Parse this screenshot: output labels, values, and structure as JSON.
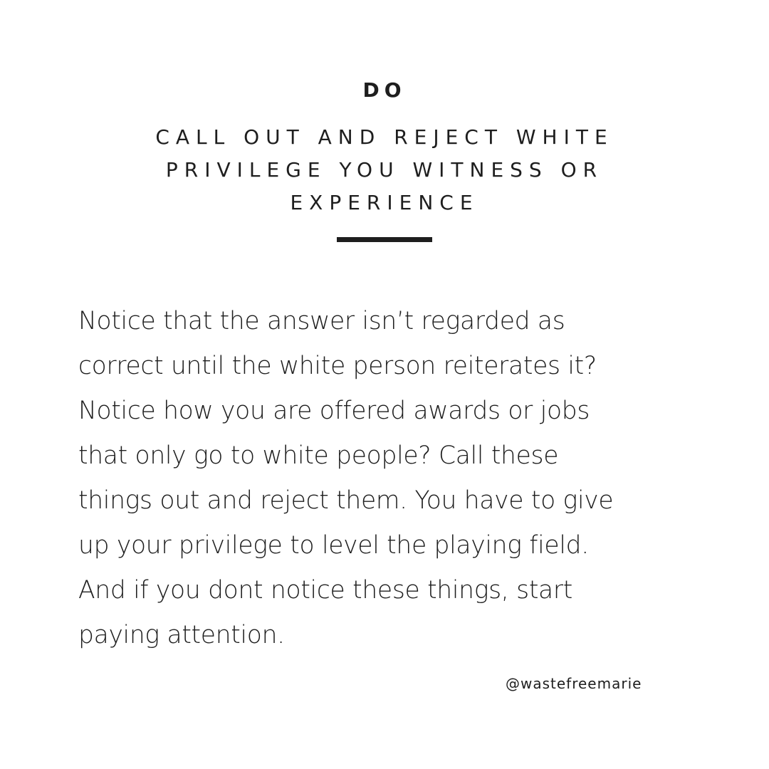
{
  "card": {
    "kicker": "DO",
    "headline_lines": [
      "CALL OUT AND REJECT WHITE",
      "PRIVILEGE YOU WITNESS OR",
      "EXPERIENCE"
    ],
    "body_lines": [
      "Notice that the answer isn’t regarded as",
      "correct until the white person reiterates it?",
      "Notice how you are offered awards or jobs",
      "that only go to white people? Call these",
      "things out and reject them. You have to give",
      "up your privilege to level the playing field.",
      "And if you dont notice these things, start",
      "paying attention."
    ],
    "handle": "@wastefreemarie"
  },
  "colors": {
    "background": "#ffffff",
    "text": "#1e1e1e",
    "divider": "#1e1e1e"
  }
}
